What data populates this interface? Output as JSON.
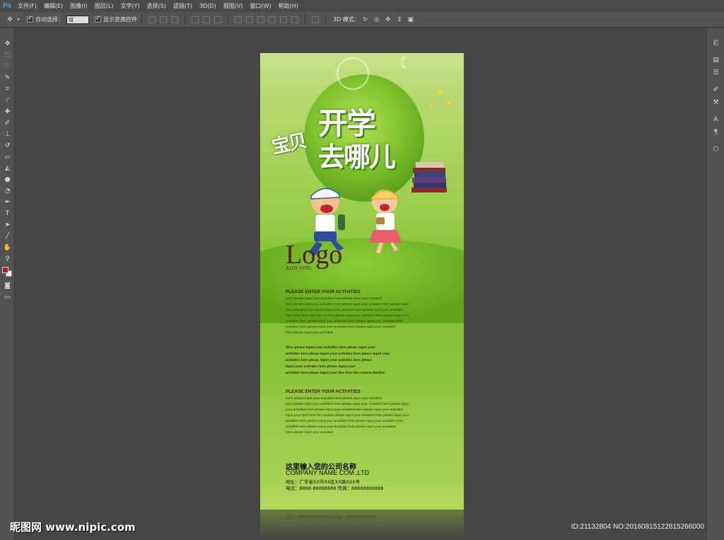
{
  "app": {
    "logo": "Ps"
  },
  "menu": [
    "文件(F)",
    "编辑(E)",
    "图像(I)",
    "图层(L)",
    "文字(Y)",
    "选择(S)",
    "滤镜(T)",
    "3D(D)",
    "视图(V)",
    "窗口(W)",
    "帮助(H)"
  ],
  "options": {
    "auto_select_label": "自动选择：",
    "auto_select_value": "组",
    "show_transform_label": "显示变换控件",
    "mode_3d_label": "3D 模式："
  },
  "colors": {
    "foreground": "#c1141e",
    "background": "#ffffff"
  },
  "poster": {
    "title_1": "宝贝",
    "title_2": "开学",
    "title_3": "去哪儿",
    "logo": "Logo",
    "logo_sub": "ADD SING",
    "section_1": {
      "heading": "PLEASE ENTER YOUR ACTIVITIES",
      "lines": [
        "Here please input your activities here please input your activities",
        "here please input your activities here please input your activities here please input",
        "your activities here please input your activities here please input your activities",
        "input your here here the content please input your activities here please input your",
        "activities here please input your activities here please input your activities here",
        "activities here please input your activities here please input your activities",
        "here please input your activities"
      ]
    },
    "italic_block": [
      "Here please input your activities here please input your",
      "activities here please input your activities here please input your",
      "activities here please input your activities here please",
      "input your activities here please input your",
      "activities here please input your line here the content lineline"
    ],
    "section_2": {
      "heading": "PLEASE ENTER YOUR ACTIVITIES",
      "lines": [
        "Here please input your activities here please input your activities",
        "here please input your activities here please input your activities here please input",
        "your activities here please input your activities here please input your activities",
        "input your here here the content please input your activities here please input your",
        "activities here please input your activities here please input your activities here",
        "activities here please input your activities here please input your activities",
        "here please input your activities"
      ]
    },
    "company": {
      "name_cn": "这里输入您的公司名称",
      "name_en": "COMPANY NAME COM.,LTD",
      "address": "地址：广东省XX市XX区XX路XXX号",
      "tel": "电话：8888-88888888   传真：88888888888"
    },
    "reflection_text": "电话：8888-88888888   传真：88888888888"
  },
  "watermark": {
    "left": "昵图网 www.nipic.com",
    "right": "ID:21132804 NO:20160815122815266000"
  }
}
